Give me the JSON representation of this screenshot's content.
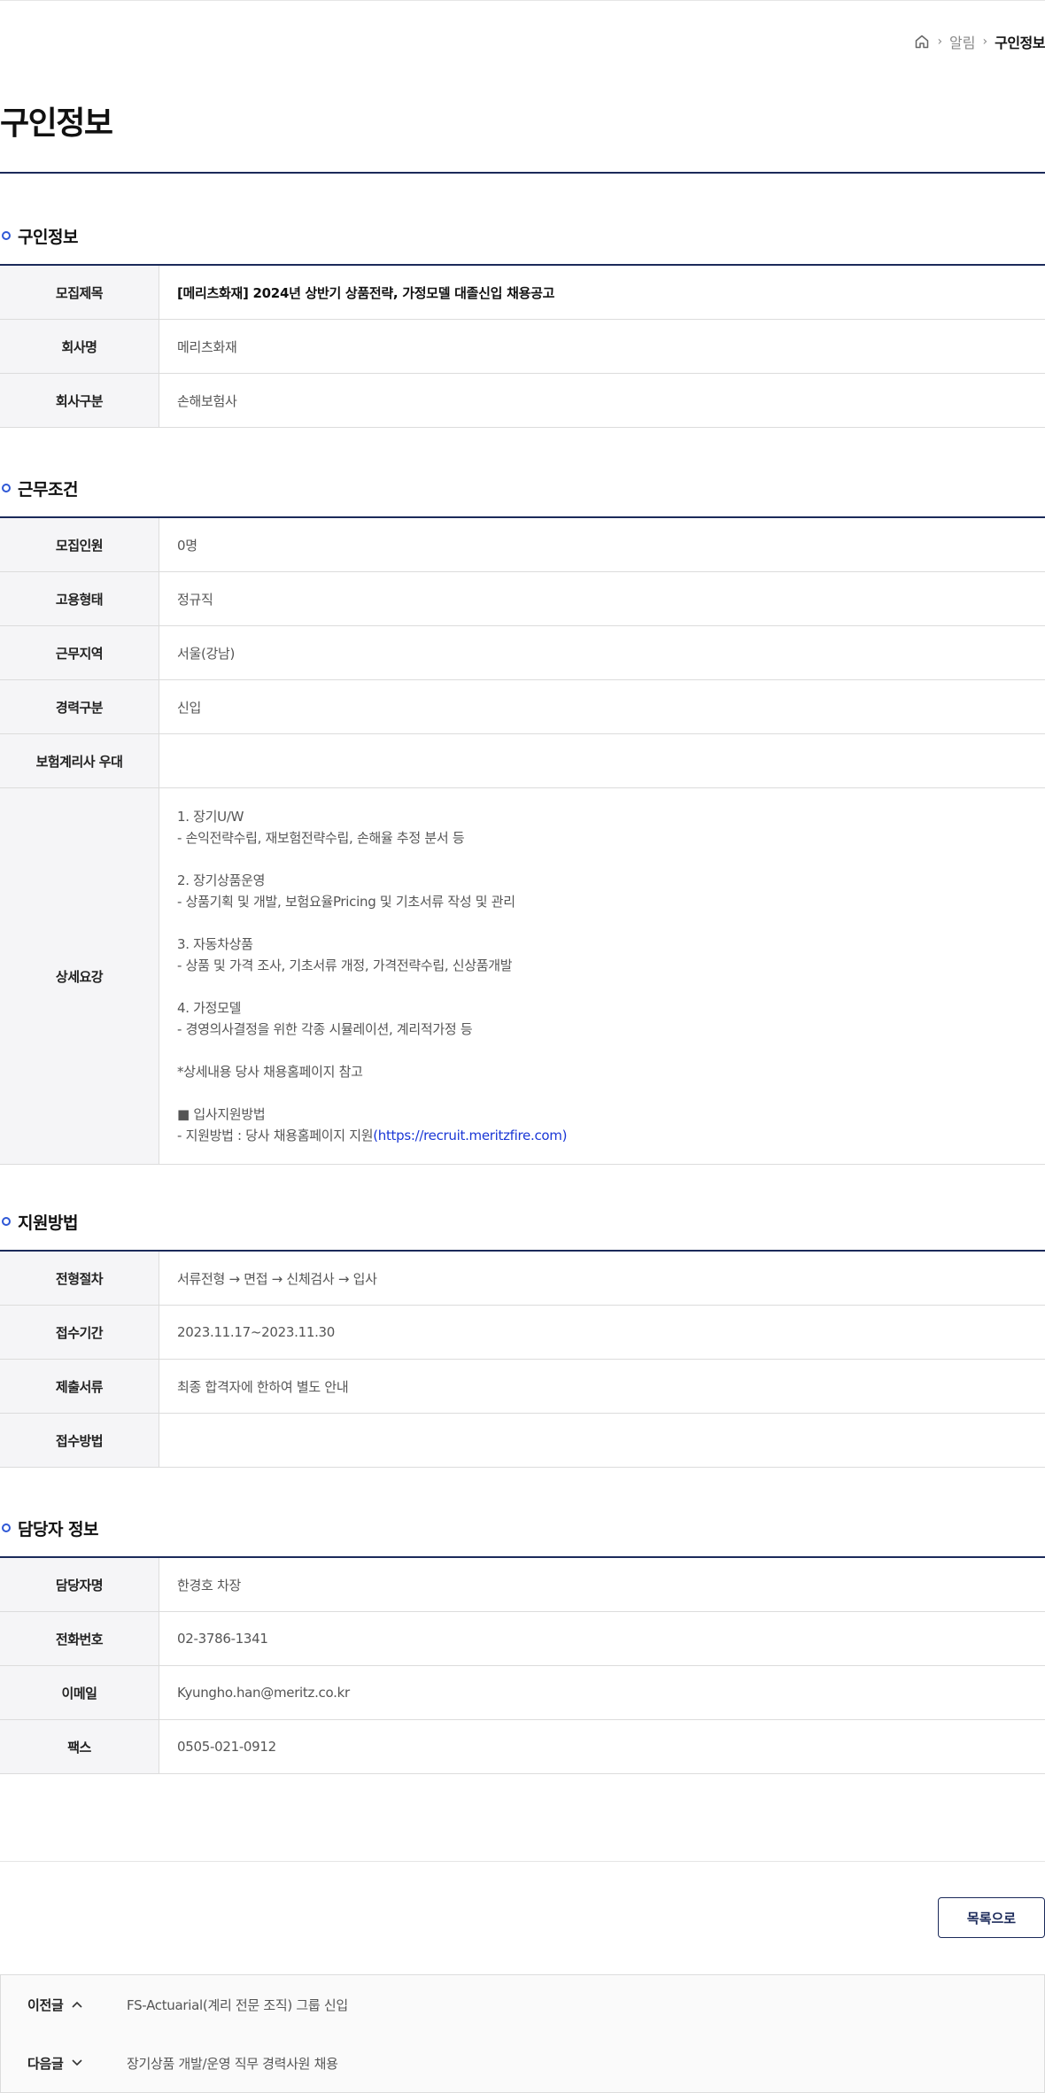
{
  "breadcrumb": {
    "items": [
      "알림"
    ],
    "current": "구인정보"
  },
  "page_title": "구인정보",
  "sections": {
    "recruit": {
      "title": "구인정보",
      "rows": [
        {
          "label": "모집제목",
          "value": "[메리츠화재] 2024년 상반기 상품전략, 가정모델 대졸신입 채용공고"
        },
        {
          "label": "회사명",
          "value": "메리츠화재"
        },
        {
          "label": "회사구분",
          "value": "손해보험사"
        }
      ]
    },
    "conditions": {
      "title": "근무조건",
      "rows": [
        {
          "label": "모집인원",
          "value": "0명"
        },
        {
          "label": "고용형태",
          "value": "정규직"
        },
        {
          "label": "근무지역",
          "value": "서울(강남)"
        },
        {
          "label": "경력구분",
          "value": "신입"
        },
        {
          "label": "보험계리사 우대",
          "value": ""
        }
      ],
      "detail_label": "상세요강",
      "detail_lines": [
        "1. 장기U/W",
        "- 손익전략수립, 재보험전략수립, 손해율 추정 분서 등",
        "",
        "2. 장기상품운영",
        "- 상품기획 및 개발, 보험요율Pricing 및 기초서류 작성 및 관리",
        "",
        "3. 자동차상품",
        "- 상품 및 가격 조사, 기초서류 개정, 가격전략수립, 신상품개발",
        "",
        "4. 가정모델",
        "- 경영의사결정을 위한 각종 시뮬레이션, 계리적가정 등",
        "",
        "*상세내용 당사 채용홈페이지 참고",
        "",
        "■ 입사지원방법"
      ],
      "detail_apply_prefix": "- 지원방법 : 당사 채용홈페이지 지원",
      "detail_apply_link": "(https://recruit.meritzfire.com)"
    },
    "apply": {
      "title": "지원방법",
      "rows": [
        {
          "label": "전형절차",
          "value": "서류전형 → 면접 → 신체검사 → 입사"
        },
        {
          "label": "접수기간",
          "value": "2023.11.17~2023.11.30"
        },
        {
          "label": "제출서류",
          "value": "최종 합격자에 한하여 별도 안내"
        },
        {
          "label": "접수방법",
          "value": ""
        }
      ]
    },
    "contact": {
      "title": "담당자 정보",
      "rows": [
        {
          "label": "담당자명",
          "value": "한경호 차장"
        },
        {
          "label": "전화번호",
          "value": "02-3786-1341"
        },
        {
          "label": "이메일",
          "value": "Kyungho.han@meritz.co.kr"
        },
        {
          "label": "팩스",
          "value": "0505-021-0912"
        }
      ]
    }
  },
  "list_button": "목록으로",
  "nav": {
    "prev_label": "이전글",
    "prev_title": "FS-Actuarial(계리 전문 조직) 그룹 신입",
    "next_label": "다음글",
    "next_title": "장기상품 개발/운영 직무 경력사원 채용"
  },
  "colors": {
    "navy": "#1b2a5a",
    "accent_blue": "#2f58d6",
    "link": "#1a37d6"
  },
  "icons": [
    "home-icon",
    "chevron-right-icon",
    "chevron-up-icon",
    "chevron-down-icon"
  ]
}
